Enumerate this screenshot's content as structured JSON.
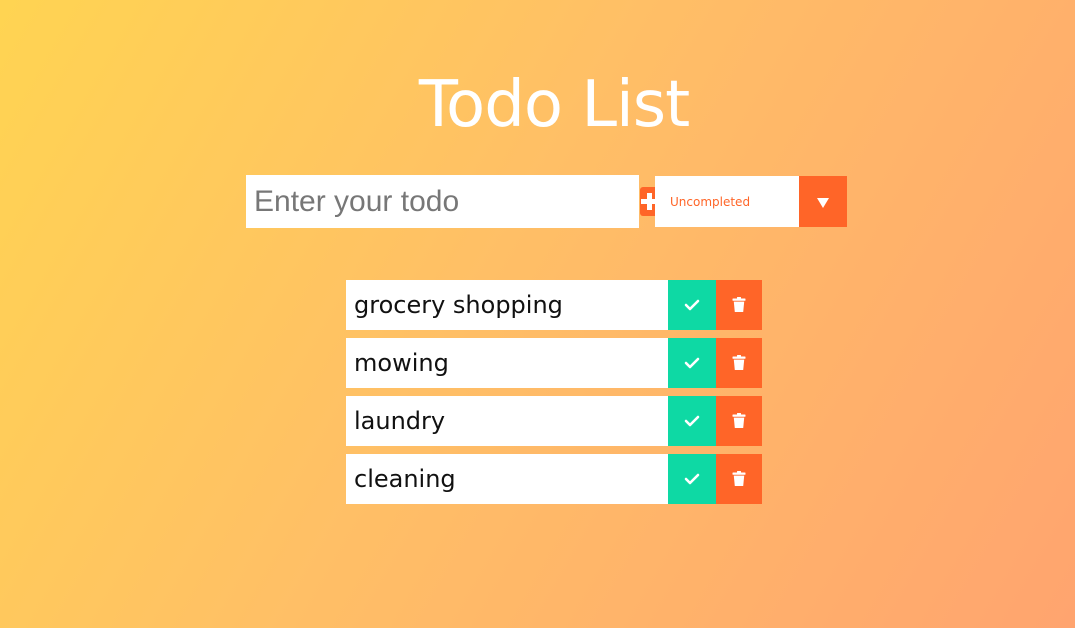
{
  "header": {
    "title": "Todo List"
  },
  "form": {
    "input_placeholder": "Enter your todo",
    "input_value": "",
    "add_icon": "plus-square-icon"
  },
  "filter": {
    "selected": "Uncompleted",
    "arrow_icon": "caret-down-icon"
  },
  "todos": [
    {
      "text": "grocery shopping"
    },
    {
      "text": "mowing"
    },
    {
      "text": "laundry"
    },
    {
      "text": "cleaning"
    }
  ],
  "colors": {
    "accent": "#ff6528",
    "complete": "#0ed9a4",
    "gradient_start": "#ffd452",
    "gradient_end": "#ffa46f"
  },
  "icons": {
    "complete": "check-icon",
    "delete": "trash-icon"
  }
}
